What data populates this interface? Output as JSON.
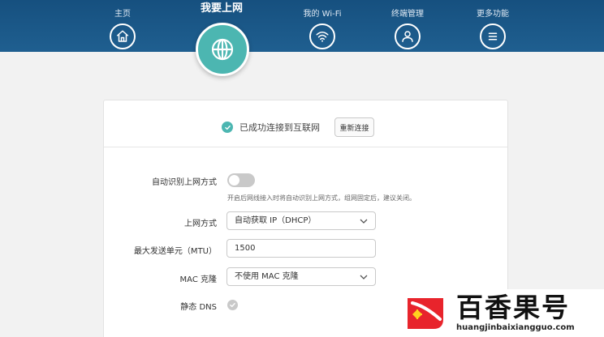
{
  "nav": {
    "items": [
      {
        "label": "主页",
        "icon": "home-icon"
      },
      {
        "label": "我要上网",
        "icon": "globe-icon"
      },
      {
        "label": "我的 Wi-Fi",
        "icon": "wifi-icon"
      },
      {
        "label": "终端管理",
        "icon": "user-icon"
      },
      {
        "label": "更多功能",
        "icon": "menu-icon"
      }
    ],
    "active_index": 1
  },
  "status": {
    "text": "已成功连接到互联网",
    "reconnect_label": "重新连接"
  },
  "form": {
    "auto_detect": {
      "label": "自动识别上网方式",
      "enabled": false,
      "hint": "开启后网线接入时将自动识别上网方式，组网固定后，建议关闭。"
    },
    "wan_mode": {
      "label": "上网方式",
      "value": "自动获取 IP（DHCP）"
    },
    "mtu": {
      "label": "最大发送单元（MTU）",
      "value": "1500"
    },
    "mac_clone": {
      "label": "MAC 克隆",
      "value": "不使用 MAC 克隆"
    },
    "static_dns": {
      "label": "静态 DNS",
      "checked": false
    }
  },
  "watermark": {
    "title": "百香果号",
    "url": "huangjinbaixiangguo.com"
  },
  "colors": {
    "header": "#1f5f90",
    "accent": "#4cb6b1",
    "toggle_off": "#c9c9c9"
  }
}
